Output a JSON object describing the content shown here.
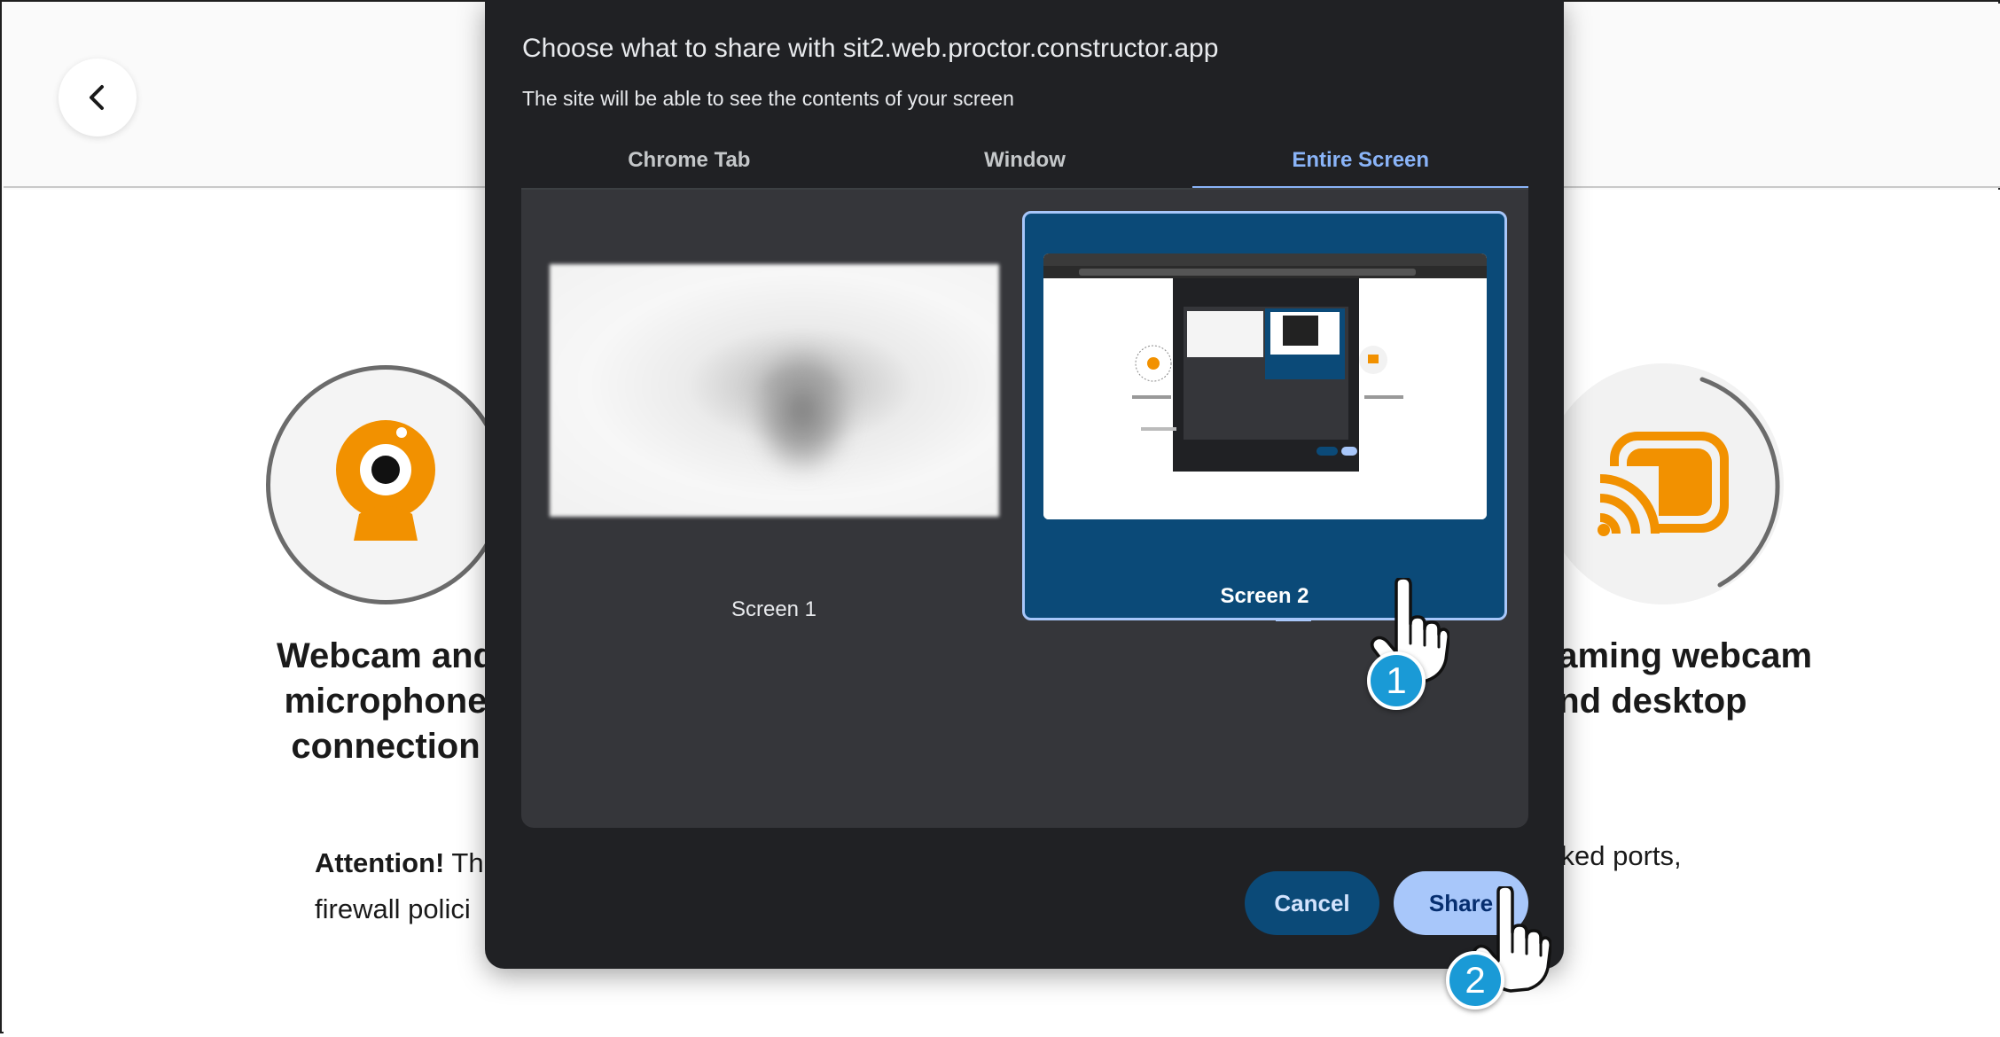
{
  "dialog": {
    "title": "Choose what to share with sit2.web.proctor.constructor.app",
    "subtitle": "The site will be able to see the contents of your screen",
    "tabs": [
      {
        "label": "Chrome Tab",
        "active": false
      },
      {
        "label": "Window",
        "active": false
      },
      {
        "label": "Entire Screen",
        "active": true
      }
    ],
    "screens": [
      {
        "label": "Screen 1",
        "selected": false
      },
      {
        "label": "Screen 2",
        "selected": true
      }
    ],
    "cancel_label": "Cancel",
    "share_label": "Share"
  },
  "background": {
    "webcam_title": "Webcam and\nmicrophone\nconnection",
    "stream_title": "eaming webcam\nand desktop",
    "attention_bold": "Attention!",
    "attention_text_1": " Th",
    "attention_text_2": "firewall polici",
    "attention_right": "cked ports,"
  },
  "annotations": {
    "step_1": "1",
    "step_2": "2"
  },
  "colors": {
    "dialog_bg": "#202124",
    "accent_blue": "#8ab4f8",
    "selected_bg": "#0b4a78",
    "icon_orange": "#f29100",
    "badge_blue": "#1a9ad6"
  }
}
